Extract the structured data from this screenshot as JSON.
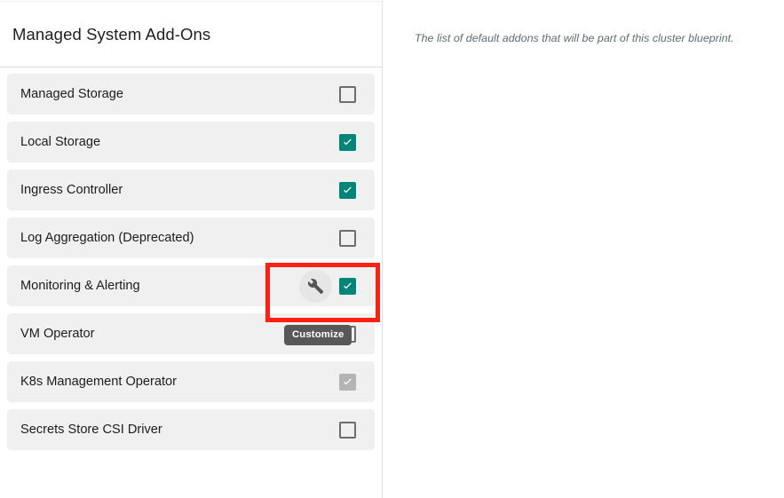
{
  "card": {
    "title": "Managed System Add-Ons",
    "addons": [
      {
        "label": "Managed Storage",
        "state": "unchecked",
        "has_wrench": false
      },
      {
        "label": "Local Storage",
        "state": "checked",
        "has_wrench": false
      },
      {
        "label": "Ingress Controller",
        "state": "checked",
        "has_wrench": false
      },
      {
        "label": "Log Aggregation (Deprecated)",
        "state": "unchecked",
        "has_wrench": false
      },
      {
        "label": "Monitoring & Alerting",
        "state": "checked",
        "has_wrench": true
      },
      {
        "label": "VM Operator",
        "state": "unchecked",
        "has_wrench": false
      },
      {
        "label": "K8s Management Operator",
        "state": "disabled-checked",
        "has_wrench": false
      },
      {
        "label": "Secrets Store CSI Driver",
        "state": "unchecked",
        "has_wrench": false
      }
    ]
  },
  "tooltip": {
    "label": "Customize"
  },
  "description": {
    "text": "The list of default addons that will be part of this cluster blueprint."
  },
  "icons": {
    "wrench": "wrench-icon",
    "check": "check-icon"
  },
  "colors": {
    "accent_teal": "#008577",
    "highlight_red": "#fc2113",
    "row_bg": "#f0f0f0",
    "tooltip_bg": "#585858",
    "disabled_gray": "#b4b4b4",
    "description_text": "#5e6b75"
  }
}
